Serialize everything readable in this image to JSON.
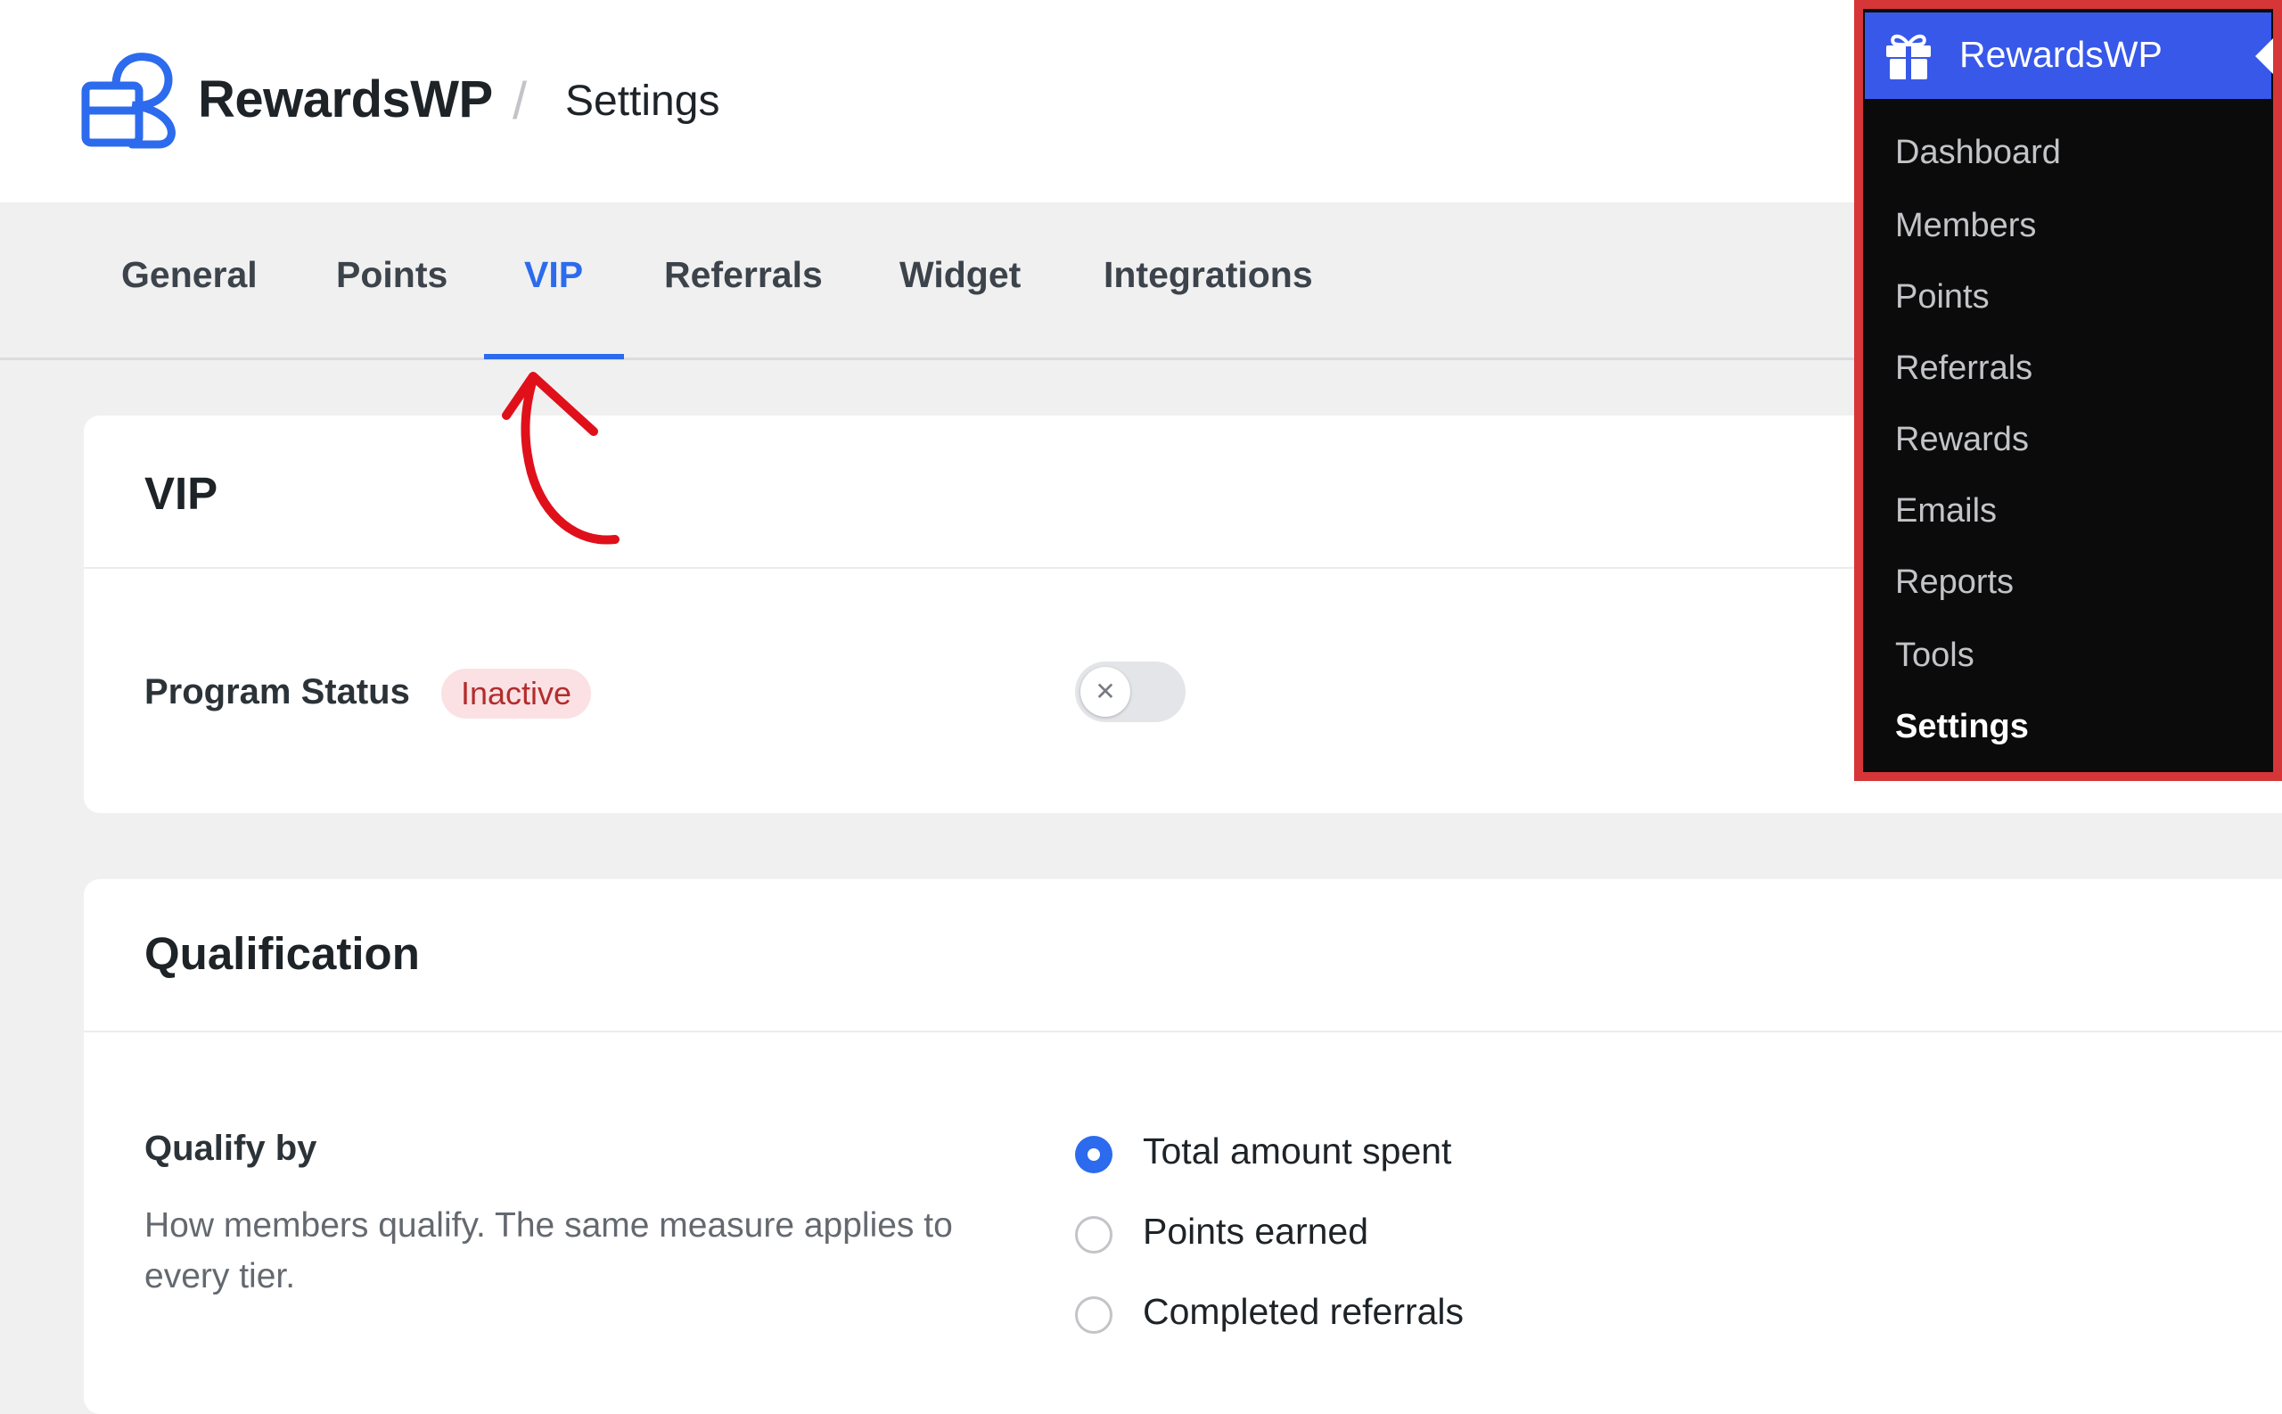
{
  "header": {
    "brand": "RewardsWP",
    "separator": "/",
    "page": "Settings"
  },
  "tabs": [
    {
      "label": "General",
      "active": false
    },
    {
      "label": "Points",
      "active": false
    },
    {
      "label": "VIP",
      "active": true
    },
    {
      "label": "Referrals",
      "active": false
    },
    {
      "label": "Widget",
      "active": false
    },
    {
      "label": "Integrations",
      "active": false
    }
  ],
  "vip_card": {
    "title": "VIP",
    "program_status_label": "Program Status",
    "status_badge": "Inactive",
    "toggle_on": false,
    "toggle_icon": "x-icon"
  },
  "qualification_card": {
    "title": "Qualification",
    "qualify_label": "Qualify by",
    "qualify_description": "How members qualify. The same measure applies to every tier.",
    "options": [
      {
        "label": "Total amount spent",
        "checked": true
      },
      {
        "label": "Points earned",
        "checked": false
      },
      {
        "label": "Completed referrals",
        "checked": false
      }
    ]
  },
  "admin_menu": {
    "title": "RewardsWP",
    "icon": "gift-icon",
    "items": [
      {
        "label": "Dashboard",
        "current": false
      },
      {
        "label": "Members",
        "current": false
      },
      {
        "label": "Points",
        "current": false
      },
      {
        "label": "Referrals",
        "current": false
      },
      {
        "label": "Rewards",
        "current": false
      },
      {
        "label": "Emails",
        "current": false
      },
      {
        "label": "Reports",
        "current": false
      },
      {
        "label": "Tools",
        "current": false
      },
      {
        "label": "Settings",
        "current": true
      }
    ]
  },
  "colors": {
    "accent": "#2c6bed",
    "admin_header": "#3858e9",
    "highlight_border": "#d63638",
    "annotation_arrow": "#e0101b",
    "badge_bg": "#fbe1e3",
    "badge_text": "#b32d2e"
  }
}
